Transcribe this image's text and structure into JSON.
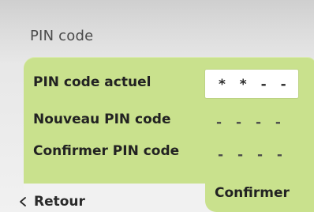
{
  "screen": {
    "title": "PIN code"
  },
  "form": {
    "current_pin_label": "PIN code actuel",
    "current_pin_value": "* * - -",
    "new_pin_label": "Nouveau PIN code",
    "new_pin_value": "- - - -",
    "confirm_pin_label": "Confirmer PIN code",
    "confirm_pin_value": "- - - -"
  },
  "actions": {
    "back_label": "Retour",
    "confirm_label": "Confirmer",
    "back_icon": "chevron-left-icon"
  },
  "colors": {
    "panel": "#c9e18d",
    "input_background": "#ffffff",
    "text": "#222222"
  }
}
